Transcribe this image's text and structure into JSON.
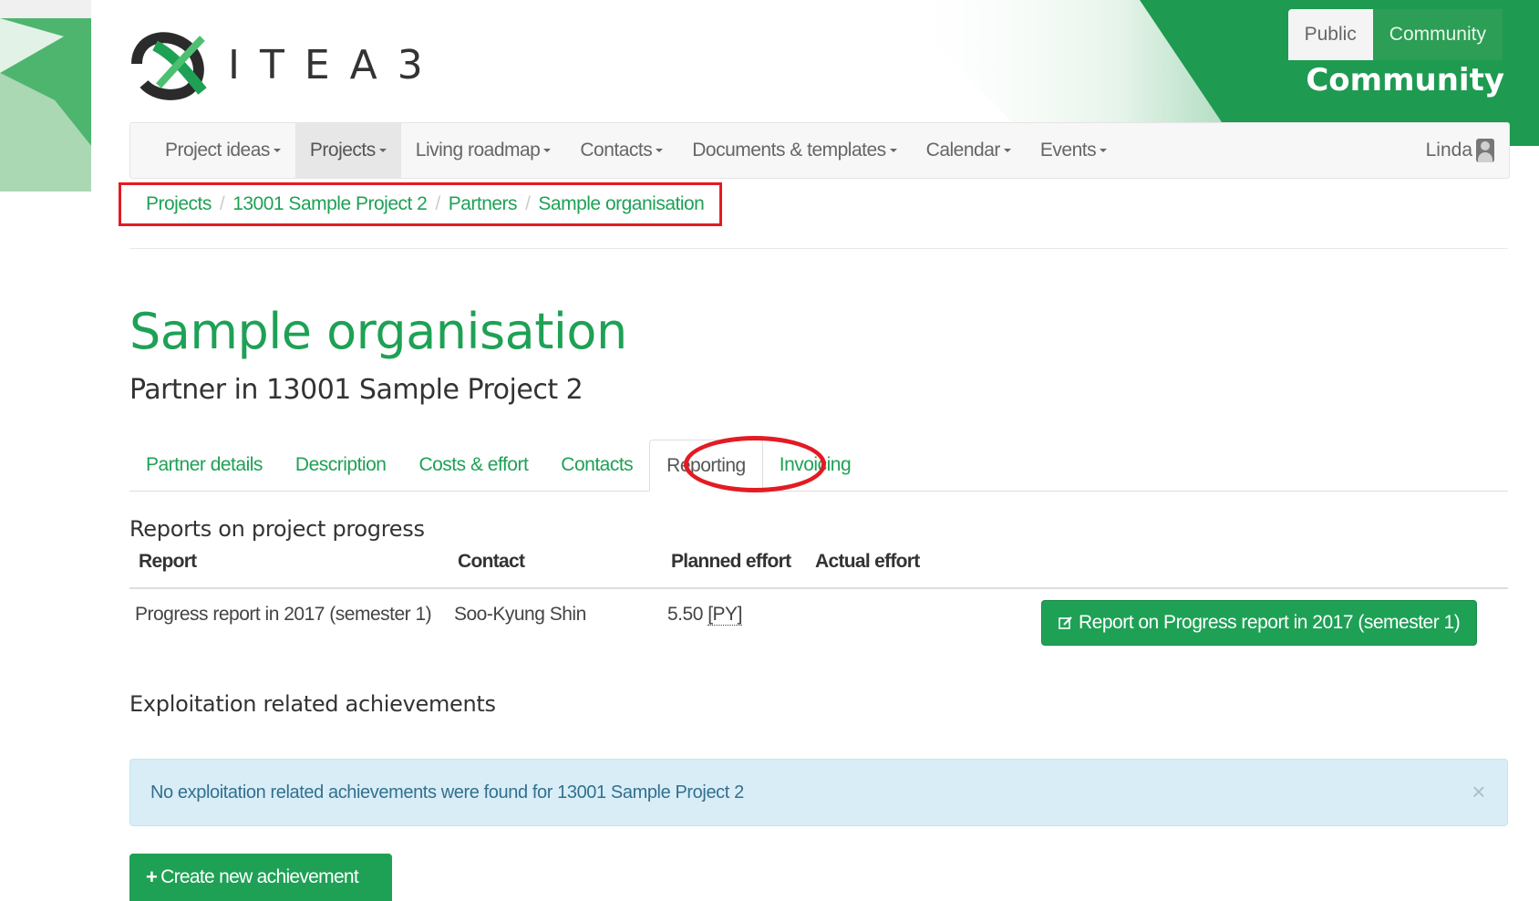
{
  "header": {
    "logo_text": "ITEA3",
    "site_switch": {
      "public_label": "Public",
      "community_label": "Community"
    },
    "community_title": "Community"
  },
  "nav": {
    "items": [
      {
        "label": "Project ideas"
      },
      {
        "label": "Projects"
      },
      {
        "label": "Living roadmap"
      },
      {
        "label": "Contacts"
      },
      {
        "label": "Documents & templates"
      },
      {
        "label": "Calendar"
      },
      {
        "label": "Events"
      }
    ],
    "user_name": "Linda"
  },
  "breadcrumb": [
    "Projects",
    "13001 Sample Project 2",
    "Partners",
    "Sample organisation"
  ],
  "page": {
    "title": "Sample organisation",
    "subtitle": "Partner in 13001 Sample Project 2"
  },
  "tabs": [
    {
      "label": "Partner details"
    },
    {
      "label": "Description"
    },
    {
      "label": "Costs & effort"
    },
    {
      "label": "Contacts"
    },
    {
      "label": "Reporting"
    },
    {
      "label": "Invoicing"
    }
  ],
  "reports": {
    "heading": "Reports on project progress",
    "columns": [
      "Report",
      "Contact",
      "Planned effort",
      "Actual effort"
    ],
    "rows": [
      {
        "report": "Progress report in 2017 (semester 1)",
        "contact": "Soo-Kyung Shin",
        "planned_value": "5.50",
        "planned_unit": "[PY]",
        "actual": "",
        "button_label": "Report on Progress report in 2017 (semester 1)"
      }
    ]
  },
  "exploitation": {
    "heading": "Exploitation related achievements",
    "alert_text": "No exploitation related achievements were found for 13001 Sample Project 2",
    "close_label": "×",
    "create_button_label": "Create new achievement"
  },
  "colors": {
    "brand_green": "#1ea155",
    "highlight_red": "#e31b23",
    "alert_bg": "#d9edf7"
  }
}
